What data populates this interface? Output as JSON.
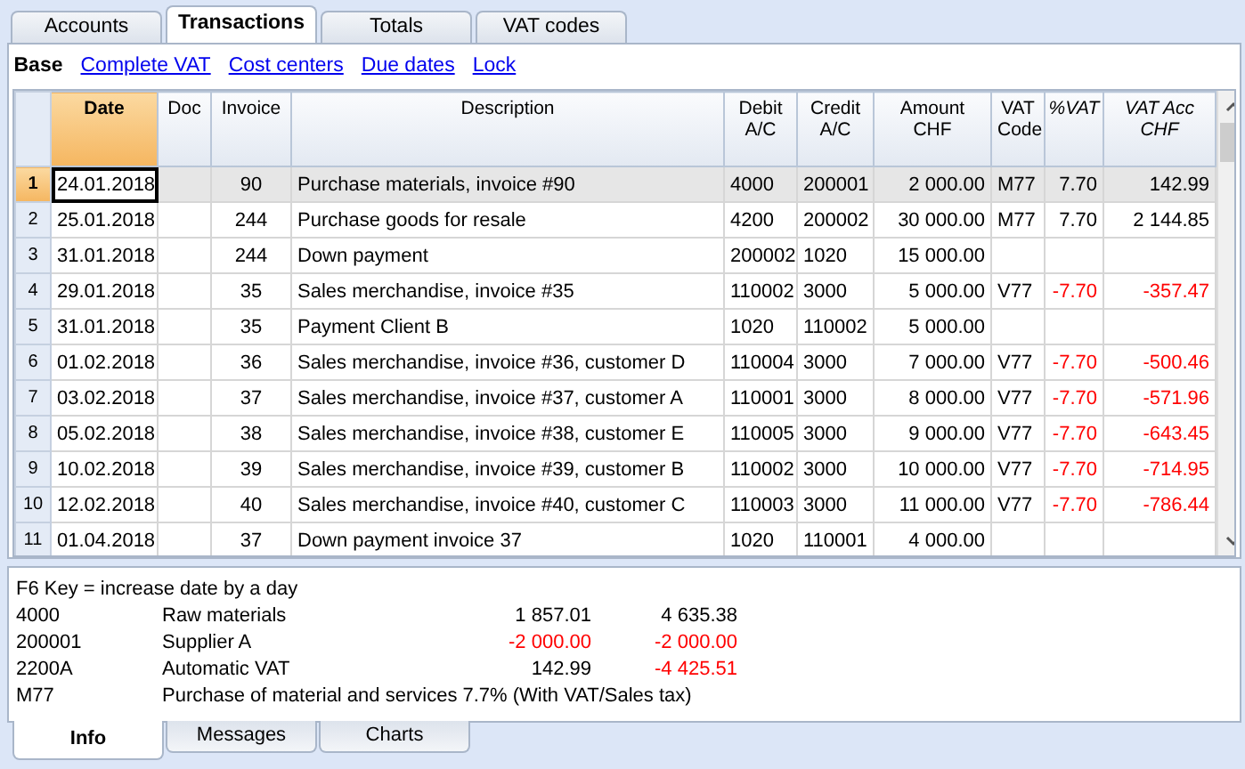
{
  "tabs": [
    {
      "label": "Accounts",
      "selected": false
    },
    {
      "label": "Transactions",
      "selected": true
    },
    {
      "label": "Totals",
      "selected": false
    },
    {
      "label": "VAT codes",
      "selected": false
    }
  ],
  "views": [
    {
      "label": "Base",
      "selected": true
    },
    {
      "label": "Complete VAT",
      "selected": false
    },
    {
      "label": "Cost centers",
      "selected": false
    },
    {
      "label": "Due dates",
      "selected": false
    },
    {
      "label": "Lock",
      "selected": false
    }
  ],
  "table": {
    "columns": [
      {
        "label": "Date",
        "selected": true
      },
      {
        "label": "Doc",
        "selected": false
      },
      {
        "label": "Invoice",
        "selected": false
      },
      {
        "label": "Description",
        "selected": false
      },
      {
        "label": "Debit A/C",
        "selected": false
      },
      {
        "label": "Credit A/C",
        "selected": false
      },
      {
        "label": "Amount CHF",
        "selected": false
      },
      {
        "label": "VAT Code",
        "selected": false
      },
      {
        "label": "%VAT",
        "selected": false
      },
      {
        "label": "VAT Acc CHF",
        "selected": false
      }
    ],
    "rows": [
      {
        "number": "1",
        "selected": true,
        "date": "24.01.2018",
        "invoice": "90",
        "description": "Purchase materials, invoice #90",
        "debit": "4000",
        "credit": "200001",
        "amount": "2 000.00",
        "vat": {
          "code": "M77",
          "percent": "7.70",
          "amount": "142.99",
          "negative": false
        }
      },
      {
        "number": "2",
        "selected": false,
        "date": "25.01.2018",
        "invoice": "244",
        "description": "Purchase goods for resale",
        "debit": "4200",
        "credit": "200002",
        "amount": "30 000.00",
        "vat": {
          "code": "M77",
          "percent": "7.70",
          "amount": "2 144.85",
          "negative": false
        }
      },
      {
        "number": "3",
        "selected": false,
        "date": "31.01.2018",
        "invoice": "244",
        "description": "Down payment",
        "debit": "200002",
        "credit": "1020",
        "amount": "15 000.00"
      },
      {
        "number": "4",
        "selected": false,
        "date": "29.01.2018",
        "invoice": "35",
        "description": "Sales merchandise, invoice #35",
        "debit": "110002",
        "credit": "3000",
        "amount": "5 000.00",
        "vat": {
          "code": "V77",
          "percent": "-7.70",
          "amount": "-357.47",
          "negative": true
        }
      },
      {
        "number": "5",
        "selected": false,
        "date": "31.01.2018",
        "invoice": "35",
        "description": "Payment Client B",
        "debit": "1020",
        "credit": "110002",
        "amount": "5 000.00"
      },
      {
        "number": "6",
        "selected": false,
        "date": "01.02.2018",
        "invoice": "36",
        "description": "Sales merchandise, invoice #36, customer D",
        "debit": "110004",
        "credit": "3000",
        "amount": "7 000.00",
        "vat": {
          "code": "V77",
          "percent": "-7.70",
          "amount": "-500.46",
          "negative": true
        }
      },
      {
        "number": "7",
        "selected": false,
        "date": "03.02.2018",
        "invoice": "37",
        "description": "Sales merchandise, invoice #37, customer A",
        "debit": "110001",
        "credit": "3000",
        "amount": "8 000.00",
        "vat": {
          "code": "V77",
          "percent": "-7.70",
          "amount": "-571.96",
          "negative": true
        }
      },
      {
        "number": "8",
        "selected": false,
        "date": "05.02.2018",
        "invoice": "38",
        "description": "Sales merchandise, invoice #38, customer E",
        "debit": "110005",
        "credit": "3000",
        "amount": "9 000.00",
        "vat": {
          "code": "V77",
          "percent": "-7.70",
          "amount": "-643.45",
          "negative": true
        }
      },
      {
        "number": "9",
        "selected": false,
        "date": "10.02.2018",
        "invoice": "39",
        "description": "Sales merchandise, invoice #39, customer B",
        "debit": "110002",
        "credit": "3000",
        "amount": "10 000.00",
        "vat": {
          "code": "V77",
          "percent": "-7.70",
          "amount": "-714.95",
          "negative": true
        }
      },
      {
        "number": "10",
        "selected": false,
        "date": "12.02.2018",
        "invoice": "40",
        "description": "Sales merchandise, invoice #40, customer C",
        "debit": "110003",
        "credit": "3000",
        "amount": "11 000.00",
        "vat": {
          "code": "V77",
          "percent": "-7.70",
          "amount": "-786.44",
          "negative": true
        }
      },
      {
        "number": "11",
        "selected": false,
        "date": "01.04.2018",
        "invoice": "37",
        "description": "Down payment invoice 37",
        "debit": "1020",
        "credit": "110001",
        "amount": "4 000.00"
      }
    ]
  },
  "info": {
    "hint": "F6 Key = increase date by a day",
    "lines": [
      {
        "code": "4000",
        "description": "Raw materials",
        "amount_1": "1 857.01",
        "amount_1_negative": false,
        "amount_2": "4 635.38",
        "amount_2_negative": false
      },
      {
        "code": "200001",
        "description": "Supplier A",
        "amount_1": "-2 000.00",
        "amount_1_negative": true,
        "amount_2": "-2 000.00",
        "amount_2_negative": true
      },
      {
        "code": "2200A",
        "description": "Automatic VAT",
        "amount_1": "142.99",
        "amount_1_negative": false,
        "amount_2": "-4 425.51",
        "amount_2_negative": true
      },
      {
        "code": "M77",
        "description": "Purchase of material and services 7.7% (With VAT/Sales tax)"
      }
    ]
  },
  "bottom_tabs": [
    {
      "label": "Info",
      "selected": true
    },
    {
      "label": "Messages",
      "selected": false
    },
    {
      "label": "Charts",
      "selected": false
    }
  ]
}
